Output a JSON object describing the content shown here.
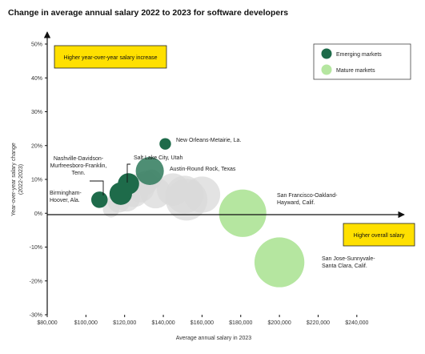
{
  "chart_data": {
    "type": "scatter",
    "subtype": "bubble",
    "title": "Change in average annual salary 2022 to 2023 for software developers",
    "xlabel": "Average annual salary in 2023",
    "ylabel": "Year-over-year salary change",
    "ylabel_sub": "(2022-2023)",
    "xlim": [
      80000,
      250000
    ],
    "ylim": [
      -30,
      50
    ],
    "x_ticks": [
      80000,
      100000,
      120000,
      140000,
      160000,
      180000,
      200000,
      220000,
      240000
    ],
    "x_tick_labels": [
      "$80,000",
      "$100,000",
      "$120,000",
      "$140,000",
      "$160,000",
      "$180,000",
      "$200,000",
      "$220,000",
      "$240,000"
    ],
    "y_ticks": [
      50,
      40,
      30,
      20,
      10,
      0,
      -10,
      -20,
      -30
    ],
    "y_tick_labels": [
      "50%",
      "40%",
      "30%",
      "20%",
      "10%",
      "0%",
      "-10%",
      "-20%",
      "-30%"
    ],
    "grid": false,
    "legend_position": "top-right",
    "quadrant_labels": {
      "top_left": "Higher year-over-year salary increase",
      "bottom_right": "Higher overall salary"
    },
    "series": [
      {
        "name": "Emerging markets",
        "color": "#1e6b4a"
      },
      {
        "name": "Mature markets",
        "color": "#b5e6a0"
      }
    ],
    "colors": {
      "emerging": "#1e6b4a",
      "emerging_translucent": "#2f7a5c",
      "mature": "#b5e6a0",
      "other": "#d9d9d9",
      "quadrant_box": "#ffe000"
    },
    "points": [
      {
        "x": 113000,
        "y": 1.2,
        "size": 3,
        "group": "other"
      },
      {
        "x": 117000,
        "y": 3.5,
        "size": 7,
        "group": "other"
      },
      {
        "x": 121000,
        "y": 4.5,
        "size": 11,
        "group": "other"
      },
      {
        "x": 125000,
        "y": 6,
        "size": 12,
        "group": "other"
      },
      {
        "x": 128000,
        "y": 7.5,
        "size": 13,
        "group": "other"
      },
      {
        "x": 131000,
        "y": 9,
        "size": 8,
        "group": "other"
      },
      {
        "x": 134000,
        "y": 10,
        "size": 5,
        "group": "other"
      },
      {
        "x": 136000,
        "y": 6,
        "size": 15,
        "group": "other"
      },
      {
        "x": 145000,
        "y": 7,
        "size": 17,
        "group": "other"
      },
      {
        "x": 151000,
        "y": 5.5,
        "size": 24,
        "group": "other"
      },
      {
        "x": 152000,
        "y": 4,
        "size": 30,
        "group": "other"
      },
      {
        "x": 160000,
        "y": 5.5,
        "size": 22,
        "group": "other"
      },
      {
        "x": 107000,
        "y": 4,
        "size": 3,
        "group": "emerging",
        "label": "Birmingham-\nHoover, Ala."
      },
      {
        "x": 118000,
        "y": 5.8,
        "size": 7,
        "group": "emerging",
        "label": "Nashville-Davidson-\nMurfreesboro-Franklin,\nTenn."
      },
      {
        "x": 122000,
        "y": 8.7,
        "size": 6,
        "group": "emerging",
        "label": "Salt Lake City, Utah"
      },
      {
        "x": 133000,
        "y": 12.5,
        "size": 12,
        "group": "emerging",
        "label": "Austin-Round Rock, Texas"
      },
      {
        "x": 141000,
        "y": 20.5,
        "size": 1,
        "group": "emerging",
        "label": "New Orleans-Metairie, La."
      },
      {
        "x": 181000,
        "y": 0,
        "size": 40,
        "group": "mature",
        "label": "San Francisco-Oakland-\nHayward, Calif."
      },
      {
        "x": 200000,
        "y": -14.5,
        "size": 45,
        "group": "mature",
        "label": "San Jose-Sunnyvale-\nSanta Clara, Calif."
      }
    ]
  }
}
